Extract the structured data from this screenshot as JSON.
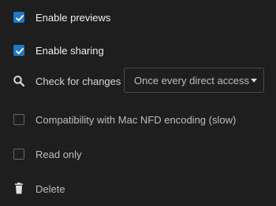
{
  "menu": {
    "items": [
      {
        "label": "Enable previews",
        "checked": true
      },
      {
        "label": "Enable sharing",
        "checked": true
      },
      {
        "label": "Check for changes",
        "icon": "search-icon"
      },
      {
        "label": "Compatibility with Mac NFD encoding (slow)",
        "checked": false
      },
      {
        "label": "Read only",
        "checked": false
      },
      {
        "label": "Delete",
        "icon": "trash-icon"
      }
    ],
    "check_changes_select": {
      "value": "Once every direct access"
    }
  },
  "colors": {
    "accent": "#1f78c1",
    "background": "#1e1e1e"
  }
}
